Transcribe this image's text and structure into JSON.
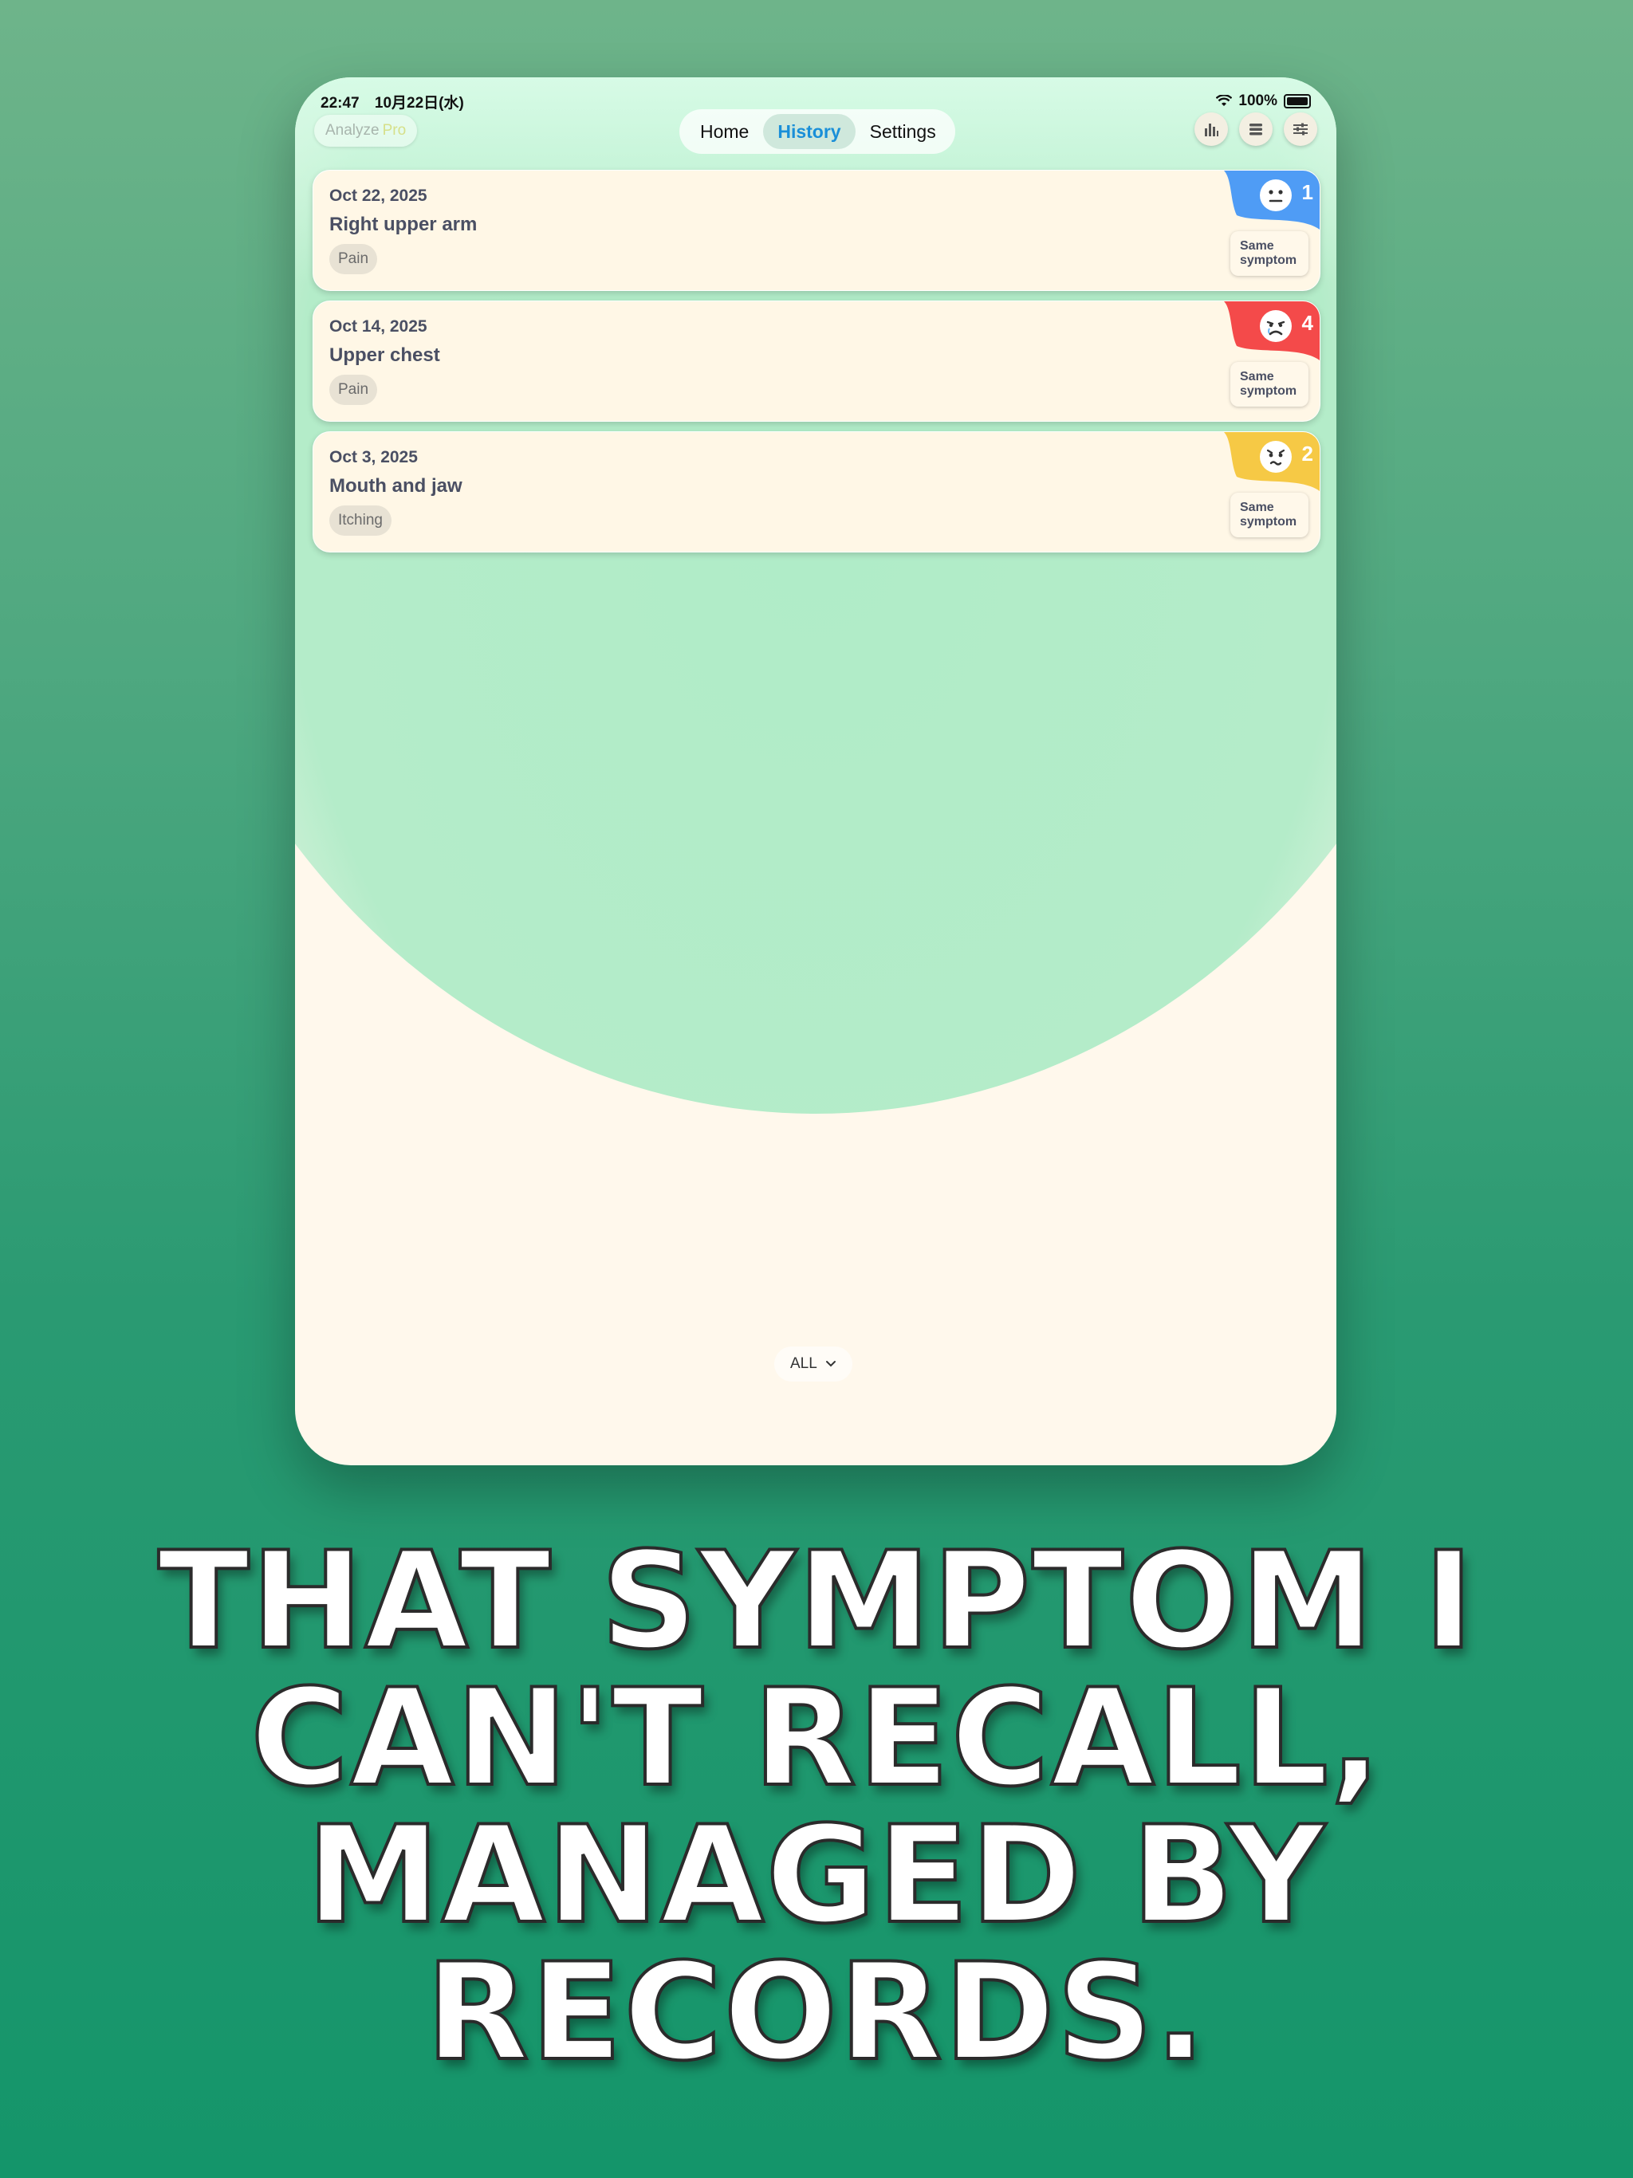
{
  "status_bar": {
    "time": "22:47",
    "date": "10月22日(水)",
    "battery": "100%"
  },
  "header": {
    "analyze_label": "Analyze",
    "pro_label": "Pro",
    "tabs": [
      {
        "label": "Home"
      },
      {
        "label": "History"
      },
      {
        "label": "Settings"
      }
    ],
    "active_tab": "History",
    "icons": [
      "bar-chart-icon",
      "list-icon",
      "sliders-icon"
    ]
  },
  "records": [
    {
      "date": "Oct 22, 2025",
      "location": "Right upper arm",
      "tag": "Pain",
      "severity": "1",
      "severity_color": "#4f9cf5",
      "face": "neutral-face-icon",
      "action": "Same symptom"
    },
    {
      "date": "Oct 14, 2025",
      "location": "Upper chest",
      "tag": "Pain",
      "severity": "4",
      "severity_color": "#f44a4a",
      "face": "crying-face-icon",
      "action": "Same symptom"
    },
    {
      "date": "Oct 3, 2025",
      "location": "Mouth and jaw",
      "tag": "Itching",
      "severity": "2",
      "severity_color": "#f6c945",
      "face": "worried-face-icon",
      "action": "Same symptom"
    }
  ],
  "filter": {
    "label": "ALL"
  },
  "headline": "That symptom I can't recall, managed by records.",
  "colors": {
    "accent": "#1a8fd8",
    "card_bg": "#fff7e6"
  }
}
